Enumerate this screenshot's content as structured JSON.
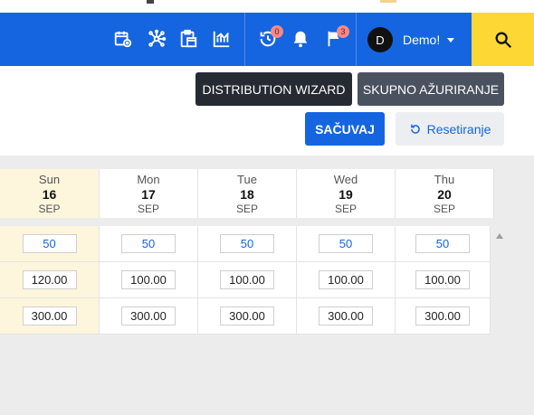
{
  "nav": {
    "icons": [
      {
        "name": "calendar-add-icon"
      },
      {
        "name": "network-icon"
      },
      {
        "name": "clipboard-calendar-icon"
      },
      {
        "name": "chart-icon"
      }
    ],
    "history_badge": "0",
    "flag_badge": "3",
    "user": {
      "initial": "D",
      "name": "Demo!"
    }
  },
  "toolbar": {
    "distribution_wizard": "DISTRIBUTION WIZARD",
    "bulk_update": "SKUPNO AŽURIRANJE",
    "save": "SAČUVAJ",
    "reset": "Resetiranje"
  },
  "days": [
    {
      "day": "Sun",
      "date": "16",
      "month": "SEP",
      "values": [
        "50",
        "120.00",
        "300.00"
      ]
    },
    {
      "day": "Mon",
      "date": "17",
      "month": "SEP",
      "values": [
        "50",
        "100.00",
        "300.00"
      ]
    },
    {
      "day": "Tue",
      "date": "18",
      "month": "SEP",
      "values": [
        "50",
        "100.00",
        "300.00"
      ]
    },
    {
      "day": "Wed",
      "date": "19",
      "month": "SEP",
      "values": [
        "50",
        "100.00",
        "300.00"
      ]
    },
    {
      "day": "Thu",
      "date": "20",
      "month": "SEP",
      "values": [
        "50",
        "100.00",
        "300.00"
      ]
    }
  ],
  "colors": {
    "brand": "#1565e0",
    "search": "#fdd835",
    "weekend": "#fdf5dc",
    "badge": "#f08a8a"
  }
}
